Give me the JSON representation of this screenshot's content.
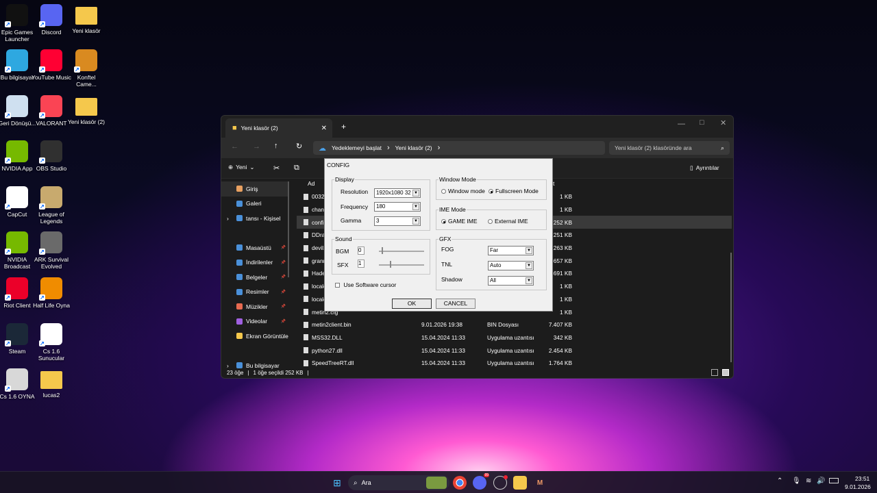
{
  "desktop_icons": [
    {
      "label": "Epic Games Launcher",
      "icon": "epic-games-icon",
      "color": "#111111"
    },
    {
      "label": "Discord",
      "icon": "discord-icon",
      "color": "#5865f2"
    },
    {
      "label": "Yeni klasör",
      "icon": "folder-icon",
      "color": "#f5c84c"
    },
    {
      "label": "Bu bilgisayar",
      "icon": "computer-icon",
      "color": "#2ea8e0"
    },
    {
      "label": "YouTube Music",
      "icon": "youtube-music-icon",
      "color": "#ff0033"
    },
    {
      "label": "Konftel Came...",
      "icon": "konftel-icon",
      "color": "#d98a20"
    },
    {
      "label": "Geri Dönüşü...",
      "icon": "recycle-bin-icon",
      "color": "#cfe0f0"
    },
    {
      "label": "VALORANT",
      "icon": "valorant-icon",
      "color": "#fa4454"
    },
    {
      "label": "Yeni klasör (2)",
      "icon": "folder-icon",
      "color": "#f5c84c"
    },
    {
      "label": "NVIDIA App",
      "icon": "nvidia-icon",
      "color": "#76b900"
    },
    {
      "label": "OBS Studio",
      "icon": "obs-icon",
      "color": "#303030"
    },
    {
      "label": "CapCut",
      "icon": "capcut-icon",
      "color": "#ffffff"
    },
    {
      "label": "League of Legends",
      "icon": "league-icon",
      "color": "#c8aa6e"
    },
    {
      "label": "NVIDIA Broadcast",
      "icon": "nvidia-broadcast-icon",
      "color": "#76b900"
    },
    {
      "label": "ARK Survival Evolved",
      "icon": "ark-icon",
      "color": "#6a6a6a"
    },
    {
      "label": "Riot Client",
      "icon": "riot-icon",
      "color": "#eb0029"
    },
    {
      "label": "Half Life Oyna",
      "icon": "half-life-icon",
      "color": "#f08c00"
    },
    {
      "label": "Steam",
      "icon": "steam-icon",
      "color": "#1b2838"
    },
    {
      "label": "Cs 1.6 Sunucular",
      "icon": "chrome-icon",
      "color": "#ffffff"
    },
    {
      "label": "Cs 1.6 OYNA",
      "icon": "cs-icon",
      "color": "#d8d8d8"
    },
    {
      "label": "lucas2",
      "icon": "folder-icon",
      "color": "#f5c84c"
    }
  ],
  "explorer": {
    "tab_title": "Yeni klasör (2)",
    "breadcrumb": [
      "Yedeklemeyi başlat",
      "Yeni klasör (2)"
    ],
    "search_placeholder": "Yeni klasör (2) klasöründe ara",
    "new_label": "Yeni",
    "details_label": "Ayrıntılar",
    "column_name": "Ad",
    "column_size": "t",
    "nav": [
      {
        "label": "Giriş",
        "icon": "home-icon"
      },
      {
        "label": "Galeri",
        "icon": "gallery-icon"
      },
      {
        "label": "tansı - Kişisel",
        "icon": "onedrive-icon"
      },
      {
        "label": "Masaüstü",
        "icon": "desktop-icon"
      },
      {
        "label": "İndirilenler",
        "icon": "download-icon"
      },
      {
        "label": "Belgeler",
        "icon": "documents-icon"
      },
      {
        "label": "Resimler",
        "icon": "pictures-icon"
      },
      {
        "label": "Müzikler",
        "icon": "music-icon"
      },
      {
        "label": "Videolar",
        "icon": "videos-icon"
      },
      {
        "label": "Ekran Görüntüle",
        "icon": "folder-icon"
      },
      {
        "label": "Bu bilgisayar",
        "icon": "computer-icon"
      }
    ],
    "files": [
      {
        "name": "00325",
        "date": "",
        "type": "",
        "size": "1 KB"
      },
      {
        "name": "chan",
        "date": "",
        "type": "",
        "size": "1 KB"
      },
      {
        "name": "confi",
        "date": "",
        "type": "",
        "size": "252 KB"
      },
      {
        "name": "DDra",
        "date": "",
        "type": "",
        "size": "251 KB"
      },
      {
        "name": "devil.",
        "date": "",
        "type": "",
        "size": "263 KB"
      },
      {
        "name": "granr",
        "date": "",
        "type": "",
        "size": "657 KB"
      },
      {
        "name": "Hade",
        "date": "",
        "type": "",
        "size": "3.691 KB"
      },
      {
        "name": "locale",
        "date": "",
        "type": "",
        "size": "1 KB"
      },
      {
        "name": "locale",
        "date": "",
        "type": "",
        "size": "1 KB"
      },
      {
        "name": "metin2.cfg",
        "date": "",
        "type": "",
        "size": "1 KB"
      },
      {
        "name": "metin2client.bin",
        "date": "9.01.2026 19:38",
        "type": "BIN Dosyası",
        "size": "7.407 KB"
      },
      {
        "name": "MSS32.DLL",
        "date": "15.04.2024 11:33",
        "type": "Uygulama uzantısı",
        "size": "342 KB"
      },
      {
        "name": "python27.dll",
        "date": "15.04.2024 11:33",
        "type": "Uygulama uzantısı",
        "size": "2.454 KB"
      },
      {
        "name": "SpeedTreeRT.dll",
        "date": "15.04.2024 11:33",
        "type": "Uygulama uzantısı",
        "size": "1.764 KB"
      }
    ],
    "status": {
      "count": "23 öğe",
      "selected": "1 öğe seçildi  252 KB"
    }
  },
  "config": {
    "title": "CONFIG",
    "display": {
      "label": "Display",
      "resolution_label": "Resolution",
      "resolution": "1920x1080 32",
      "frequency_label": "Frequency",
      "frequency": "180",
      "gamma_label": "Gamma",
      "gamma": "3"
    },
    "sound": {
      "label": "Sound",
      "bgm_label": "BGM",
      "bgm": "0",
      "sfx_label": "SFX",
      "sfx": "1"
    },
    "software_cursor": "Use Software cursor",
    "window_mode": {
      "label": "Window Mode",
      "opt1": "Window mode",
      "opt2": "Fullscreen Mode",
      "selected": "Fullscreen Mode"
    },
    "ime_mode": {
      "label": "IME Mode",
      "opt1": "GAME IME",
      "opt2": "External IME",
      "selected": "GAME IME"
    },
    "gfx": {
      "label": "GFX",
      "fog_label": "FOG",
      "fog": "Far",
      "tnl_label": "TNL",
      "tnl": "Auto",
      "shadow_label": "Shadow",
      "shadow": "All"
    },
    "ok": "OK",
    "cancel": "CANCEL"
  },
  "taskbar": {
    "search": "Ara",
    "time": "23:51",
    "date": "9.01.2026",
    "discord_badge": "99"
  }
}
